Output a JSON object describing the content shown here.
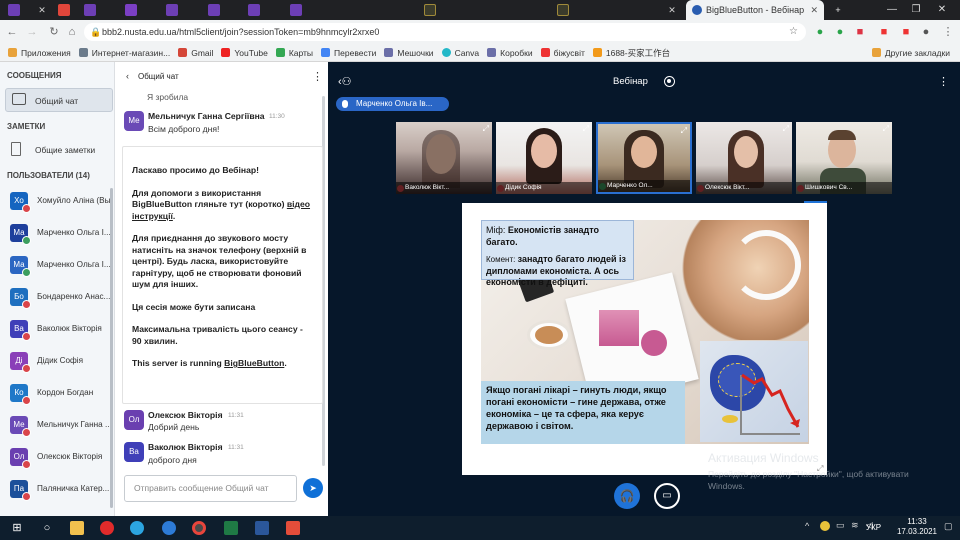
{
  "browser": {
    "active_tab_title": "BigBlueButton - Вебінар",
    "url": "bbb2.nusta.edu.ua/html5client/join?sessionToken=mb9hnmcylr2xrxe0",
    "bookmarks": [
      "Приложения",
      "Интернет-магазин...",
      "Gmail",
      "YouTube",
      "Карты",
      "Перевести",
      "Мешочки",
      "Canva",
      "Коробки",
      "біжусвіт",
      "1688-买家工作台"
    ],
    "other_bookmarks": "Другие закладки"
  },
  "sidebar": {
    "messages_header": "СООБЩЕНИЯ",
    "public_chat": "Общий чат",
    "notes_header": "ЗАМЕТКИ",
    "shared_notes": "Общие заметки",
    "users_header": "ПОЛЬЗОВАТЕЛИ (14)",
    "users": [
      {
        "initials": "Хо",
        "name": "Хомуйло Аліна (Вы)",
        "color": "#1565c0"
      },
      {
        "initials": "Ма",
        "name": "Марченко Ольга І...",
        "color": "#1e3f9c"
      },
      {
        "initials": "Ма",
        "name": "Марченко Ольга І...",
        "color": "#2b66c2"
      },
      {
        "initials": "Бо",
        "name": "Бондаренко Анас...",
        "color": "#1e6fbf"
      },
      {
        "initials": "Ва",
        "name": "Ваколюк Вікторія",
        "color": "#3f3fb8"
      },
      {
        "initials": "Ді",
        "name": "Дідик Софія",
        "color": "#8a3fb8"
      },
      {
        "initials": "Ко",
        "name": "Кордон Богдан",
        "color": "#1f78c8"
      },
      {
        "initials": "Ме",
        "name": "Мельничук Ганна ...",
        "color": "#6a4ab6"
      },
      {
        "initials": "Ол",
        "name": "Олексюк Вікторія",
        "color": "#6a3fb0"
      },
      {
        "initials": "Па",
        "name": "Паляничка Катер...",
        "color": "#1b4f9a"
      }
    ]
  },
  "chat": {
    "title": "Общий чат",
    "scroll_text": "Я зробила",
    "m1": {
      "initials": "Ме",
      "name": "Мельничук Ганна Сергіївна",
      "time": "11:30",
      "text": "Всім доброго дня!"
    },
    "welcome": {
      "p1_a": "Ласкаво просимо до ",
      "p1_b": "Вебінар",
      "p1_c": "!",
      "p2_a": "Для допомоги з використання BigBlueButton гляньте тут (коротко) ",
      "p2_link": "відео інструкції",
      "p2_c": ".",
      "p3": "Для приєднання до звукового мосту натисніть на значок телефону (верхній в центрі). Будь ласка, використовуйте гарнітуру, щоб не створювати фоновий шум для інших.",
      "p4": "Ця сесія може бути записана",
      "p5": "Максимальна тривалість цього сеансу - 90 хвилин.",
      "p6_a": "This server is running ",
      "p6_link": "BigBlueButton",
      "p6_c": "."
    },
    "m2": {
      "initials": "Ол",
      "name": "Олексюк Вікторія",
      "time": "11:31",
      "text": "Добрий день"
    },
    "m3": {
      "initials": "Ва",
      "name": "Ваколюк Вікторія",
      "time": "11:31",
      "text": "доброго дня"
    },
    "input_placeholder": "Отправить сообщение Общий чат"
  },
  "main": {
    "title": "Вебінар",
    "presenter_badge": "Марченко Ольга Ів...",
    "cams": [
      "Ваколюк Вікт...",
      "Дідик Софія",
      "Марченко Ол...",
      "Олексюк Вікт...",
      "Шишкович Св..."
    ],
    "slide": {
      "myth_a": "Міф: ",
      "myth_b": "Економістів занадто багато.",
      "comment_a": "Комент: ",
      "comment_b": "занадто багато людей із дипломами економіста. А ось економісти в дефіциті.",
      "bottom": "Якщо погані лікарі – гинуть люди, якщо погані економісти – гине держава, отже економіка – це та сфера, яка керує державою і світом."
    },
    "activation_title": "Активация Windows",
    "activation_text": "Перейдіть до розділу \"Настройки\", щоб активувати Windows."
  },
  "taskbar": {
    "lang": "УКР",
    "time": "11:33",
    "date": "17.03.2021"
  }
}
